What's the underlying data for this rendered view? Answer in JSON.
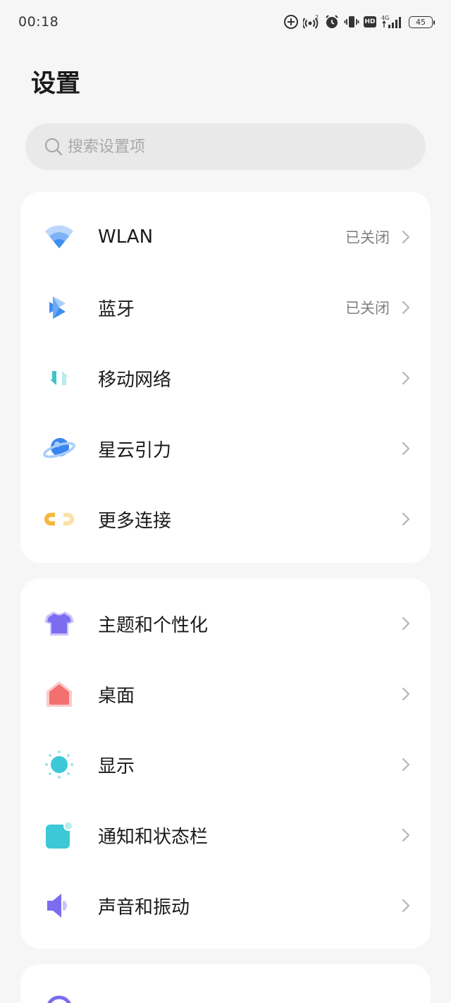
{
  "status_bar": {
    "time": "00:18",
    "network": "4G",
    "hd": "HD",
    "battery": "45"
  },
  "page": {
    "title": "设置"
  },
  "search": {
    "placeholder": "搜索设置项"
  },
  "connectivity": [
    {
      "label": "WLAN",
      "value": "已关闭",
      "icon": "wifi-icon"
    },
    {
      "label": "蓝牙",
      "value": "已关闭",
      "icon": "bluetooth-icon"
    },
    {
      "label": "移动网络",
      "value": "",
      "icon": "mobile-data-icon"
    },
    {
      "label": "星云引力",
      "value": "",
      "icon": "planet-icon"
    },
    {
      "label": "更多连接",
      "value": "",
      "icon": "link-icon"
    }
  ],
  "personalization": [
    {
      "label": "主题和个性化",
      "icon": "tshirt-icon"
    },
    {
      "label": "桌面",
      "icon": "home-icon"
    },
    {
      "label": "显示",
      "icon": "sun-icon"
    },
    {
      "label": "通知和状态栏",
      "icon": "notification-icon"
    },
    {
      "label": "声音和振动",
      "icon": "speaker-icon"
    }
  ],
  "next_section": [
    {
      "label": ""
    }
  ],
  "colors": {
    "background": "#f6f6f6",
    "card": "#ffffff",
    "wifi": "#4a90f0",
    "bluetooth": "#3d8ef0",
    "mobile": "#3cc4c8",
    "planet": "#3a86f0",
    "link": "#f5b83d",
    "theme": "#7b6cf0",
    "home": "#f27070",
    "display": "#3cc8d6",
    "notification": "#3cc8d6",
    "sound": "#7b6cf0"
  }
}
